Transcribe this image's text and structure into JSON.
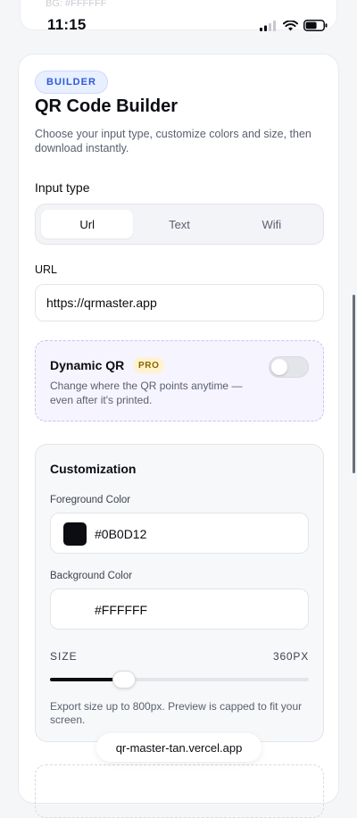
{
  "top_card": {
    "ghost_text": "BG: #FFFFFF"
  },
  "status_bar": {
    "time": "11:15"
  },
  "header": {
    "badge": "BUILDER",
    "title": "QR Code Builder",
    "subtitle": "Choose your input type, customize colors and size, then download instantly."
  },
  "input_type": {
    "label": "Input type",
    "options": [
      "Url",
      "Text",
      "Wifi"
    ],
    "selected": "Url"
  },
  "url_field": {
    "label": "URL",
    "value": "https://qrmaster.app"
  },
  "dynamic_qr": {
    "title": "Dynamic QR",
    "badge": "PRO",
    "description": "Change where the QR points anytime — even after it's printed.",
    "enabled": false
  },
  "customization": {
    "title": "Customization",
    "foreground": {
      "label": "Foreground Color",
      "value": "#0B0D12",
      "swatch": "#0b0d12"
    },
    "background": {
      "label": "Background Color",
      "value": "#FFFFFF",
      "swatch": "#ffffff"
    },
    "size": {
      "label": "SIZE",
      "value_text": "360PX",
      "value": 360,
      "min": 0,
      "max": 800,
      "fraction": 0.285
    },
    "help": "Export size up to 800px. Preview is capped to fit your screen."
  },
  "browser": {
    "url": "qr-master-tan.vercel.app"
  },
  "colors": {
    "accent": "#2d5bd7",
    "text": "#0b0d12",
    "muted": "#5a6070",
    "pro": "#fff3cf"
  }
}
